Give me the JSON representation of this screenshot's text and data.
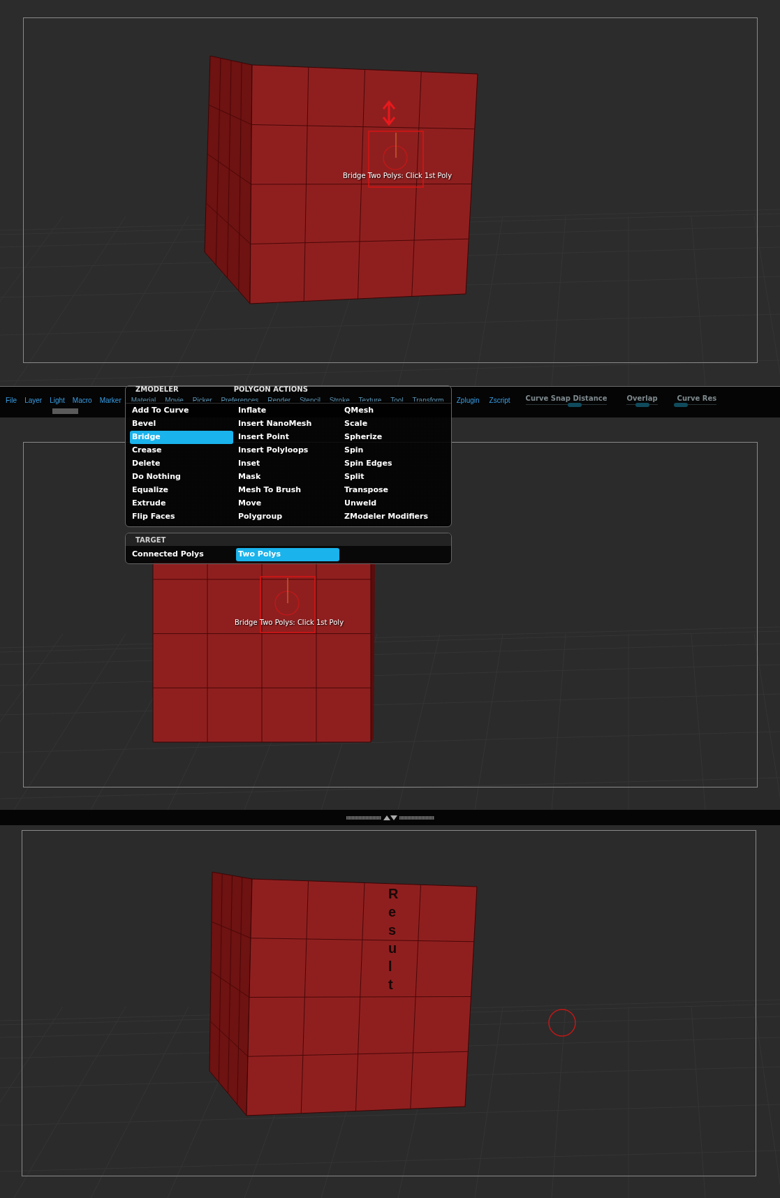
{
  "top_viewport": {
    "hint": "Bridge Two Polys: Click 1st Poly"
  },
  "menu_bar": {
    "items": [
      {
        "label": "File",
        "dimmed": false
      },
      {
        "label": "Layer",
        "dimmed": false
      },
      {
        "label": "Light",
        "dimmed": false
      },
      {
        "label": "Macro",
        "dimmed": false
      },
      {
        "label": "Marker",
        "dimmed": false
      },
      {
        "label": "Material",
        "dimmed": true
      },
      {
        "label": "Movie",
        "dimmed": true
      },
      {
        "label": "Picker",
        "dimmed": true
      },
      {
        "label": "Preferences",
        "dimmed": true
      },
      {
        "label": "Render",
        "dimmed": true
      },
      {
        "label": "Stencil",
        "dimmed": true
      },
      {
        "label": "Stroke",
        "dimmed": true
      },
      {
        "label": "Texture",
        "dimmed": true
      },
      {
        "label": "Tool",
        "dimmed": true
      },
      {
        "label": "Transform",
        "dimmed": true
      },
      {
        "label": "Zplugin",
        "dimmed": false
      },
      {
        "label": "Zscript",
        "dimmed": false
      }
    ],
    "sliders": [
      {
        "label": "Curve Snap Distance",
        "level": 0.6
      },
      {
        "label": "Overlap",
        "level": 0.5
      },
      {
        "label": "Curve Res",
        "level": 0.1
      }
    ]
  },
  "zmodeler_menu": {
    "title": "ZMODELER",
    "section_title": "POLYGON ACTIONS",
    "columns": [
      [
        {
          "label": "Add To Curve",
          "selected": false
        },
        {
          "label": "Bevel",
          "selected": false
        },
        {
          "label": "Bridge",
          "selected": true
        },
        {
          "label": "Crease",
          "selected": false
        },
        {
          "label": "Delete",
          "selected": false
        },
        {
          "label": "Do Nothing",
          "selected": false
        },
        {
          "label": "Equalize",
          "selected": false
        },
        {
          "label": "Extrude",
          "selected": false
        },
        {
          "label": "Flip Faces",
          "selected": false
        }
      ],
      [
        {
          "label": "Inflate",
          "selected": false
        },
        {
          "label": "Insert NanoMesh",
          "selected": false
        },
        {
          "label": "Insert Point",
          "selected": false
        },
        {
          "label": "Insert Polyloops",
          "selected": false
        },
        {
          "label": "Inset",
          "selected": false
        },
        {
          "label": "Mask",
          "selected": false
        },
        {
          "label": "Mesh To Brush",
          "selected": false
        },
        {
          "label": "Move",
          "selected": false
        },
        {
          "label": "Polygroup",
          "selected": false
        }
      ],
      [
        {
          "label": "QMesh",
          "selected": false
        },
        {
          "label": "Scale",
          "selected": false
        },
        {
          "label": "Spherize",
          "selected": false
        },
        {
          "label": "Spin",
          "selected": false
        },
        {
          "label": "Spin Edges",
          "selected": false
        },
        {
          "label": "Split",
          "selected": false
        },
        {
          "label": "Transpose",
          "selected": false
        },
        {
          "label": "Unweld",
          "selected": false
        },
        {
          "label": "ZModeler Modifiers",
          "selected": false
        }
      ]
    ],
    "target": {
      "title": "TARGET",
      "items": [
        {
          "label": "Connected Polys",
          "selected": false
        },
        {
          "label": "Two Polys",
          "selected": true
        }
      ]
    }
  },
  "middle_viewport": {
    "hint": "Bridge Two Polys: Click 1st Poly"
  },
  "result_viewport": {
    "caption": "Result"
  }
}
